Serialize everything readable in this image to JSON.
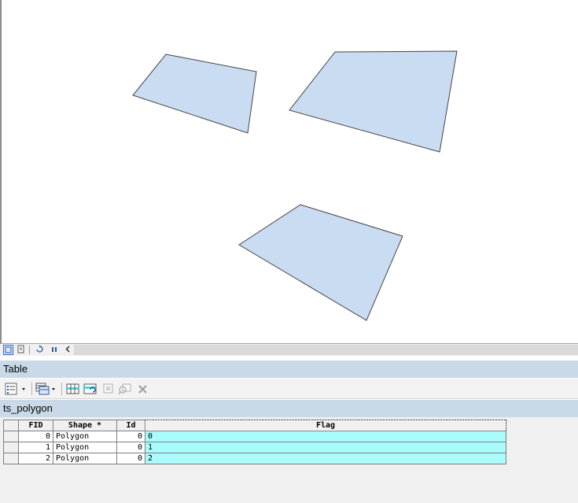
{
  "map": {
    "polygon_fill": "#cadcf2",
    "polygon_stroke": "#444444"
  },
  "view_bar": {
    "buttons": [
      "layout-view-icon",
      "data-view-icon",
      "refresh-icon",
      "pause-icon",
      "scroll-left-icon"
    ]
  },
  "table_window": {
    "title": "Table",
    "layer_tab": "ts_polygon",
    "toolbar_icons": [
      "table-options-icon",
      "related-tables-icon",
      "select-by-attributes-icon",
      "switch-selection-icon",
      "clear-selection-icon",
      "zoom-to-selected-icon",
      "delete-selected-icon"
    ]
  },
  "attribute_table": {
    "columns": [
      "FID",
      "Shape *",
      "Id",
      "Flag"
    ],
    "rows": [
      {
        "fid": "0",
        "shape": "Polygon",
        "id": "0",
        "flag": "0"
      },
      {
        "fid": "1",
        "shape": "Polygon",
        "id": "0",
        "flag": "1"
      },
      {
        "fid": "2",
        "shape": "Polygon",
        "id": "0",
        "flag": "2"
      }
    ],
    "flag_color": "#aafcfc"
  }
}
